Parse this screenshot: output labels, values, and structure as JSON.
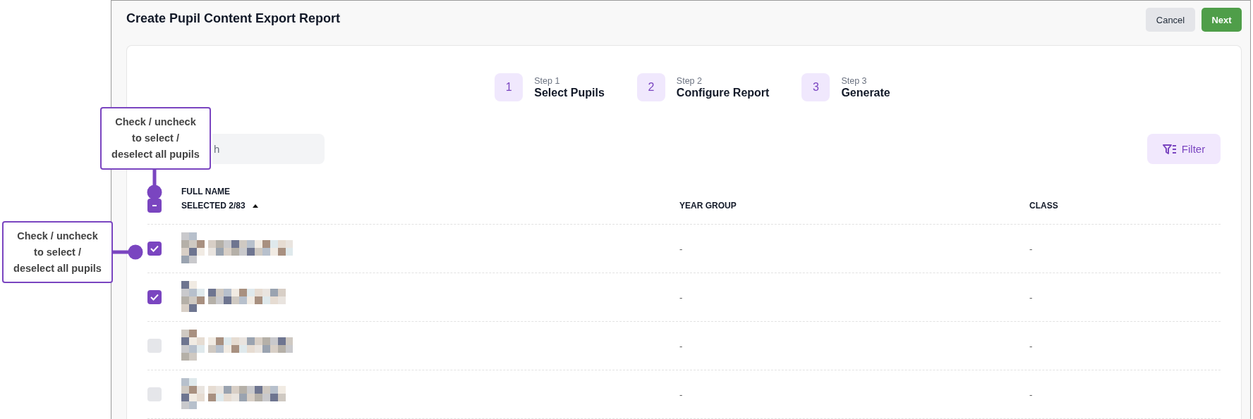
{
  "window": {
    "title": "Create Pupil Content Export Report"
  },
  "buttons": [
    {
      "label": "Cancel",
      "kind": "secondary"
    },
    {
      "label": "Next",
      "kind": "primary"
    }
  ],
  "steps": [
    {
      "number": "1",
      "caption": "Step 1",
      "label": "Select Pupils"
    },
    {
      "number": "2",
      "caption": "Step 2",
      "label": "Configure Report"
    },
    {
      "number": "3",
      "caption": "Step 3",
      "label": "Generate"
    }
  ],
  "search": {
    "placeholder": "h"
  },
  "filter_button": {
    "label": "Filter"
  },
  "table": {
    "select_all": {
      "indeterminate": true
    },
    "columns": [
      {
        "lines": [
          "FULL NAME",
          "SELECTED 2/83"
        ],
        "sort_ascending": true
      },
      {
        "lines": [
          "YEAR GROUP"
        ]
      },
      {
        "lines": [
          "CLASS"
        ]
      }
    ],
    "rows": [
      {
        "checked": true,
        "year_group": "-",
        "class": "-"
      },
      {
        "checked": true,
        "year_group": "-",
        "class": "-"
      },
      {
        "checked": false,
        "year_group": "-",
        "class": "-"
      },
      {
        "checked": false,
        "year_group": "-",
        "class": "-"
      }
    ]
  },
  "callouts": [
    {
      "text": "Check / uncheck to select / deselect all pupils"
    },
    {
      "text": "Check / uncheck to select / deselect all pupils"
    }
  ]
}
